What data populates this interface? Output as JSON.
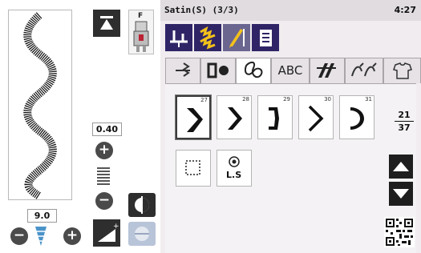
{
  "left": {
    "width_value": "9.0",
    "length_value": "0.40",
    "plus_symbol": "+",
    "minus_symbol": "−",
    "presser_foot_label": "F"
  },
  "right": {
    "title": "Satin(S) (3/3)",
    "time": "4:27",
    "tabs": [
      {
        "icon": "straight-stitch-tab-icon",
        "label": ""
      },
      {
        "icon": "buttonhole-tab-icon",
        "label": ""
      },
      {
        "icon": "decorative-stitch-tab-icon",
        "label": ""
      },
      {
        "icon": "",
        "label": "ABC"
      },
      {
        "icon": "satin-tab-icon",
        "label": ""
      },
      {
        "icon": "cross-stitch-tab-icon",
        "label": ""
      },
      {
        "icon": "garment-tab-icon",
        "label": ""
      }
    ],
    "patterns": [
      {
        "number": "27",
        "icon": "satin-chevron-right-icon"
      },
      {
        "number": "28",
        "icon": "satin-chevron-right-icon"
      },
      {
        "number": "29",
        "icon": "satin-bracket-icon"
      },
      {
        "number": "30",
        "icon": "satin-chevron-right-icon"
      },
      {
        "number": "31",
        "icon": "satin-bracket-icon"
      }
    ],
    "option_buttons": [
      {
        "icon": "dotted-square-icon",
        "label": ""
      },
      {
        "icon": "ls-icon",
        "label": "L.S"
      }
    ],
    "page": {
      "current": "21",
      "total": "37"
    }
  },
  "colors": {
    "category_active": "#2f2566",
    "category_accent": "#f3c21b",
    "panel_bg": "#f0ecef"
  }
}
